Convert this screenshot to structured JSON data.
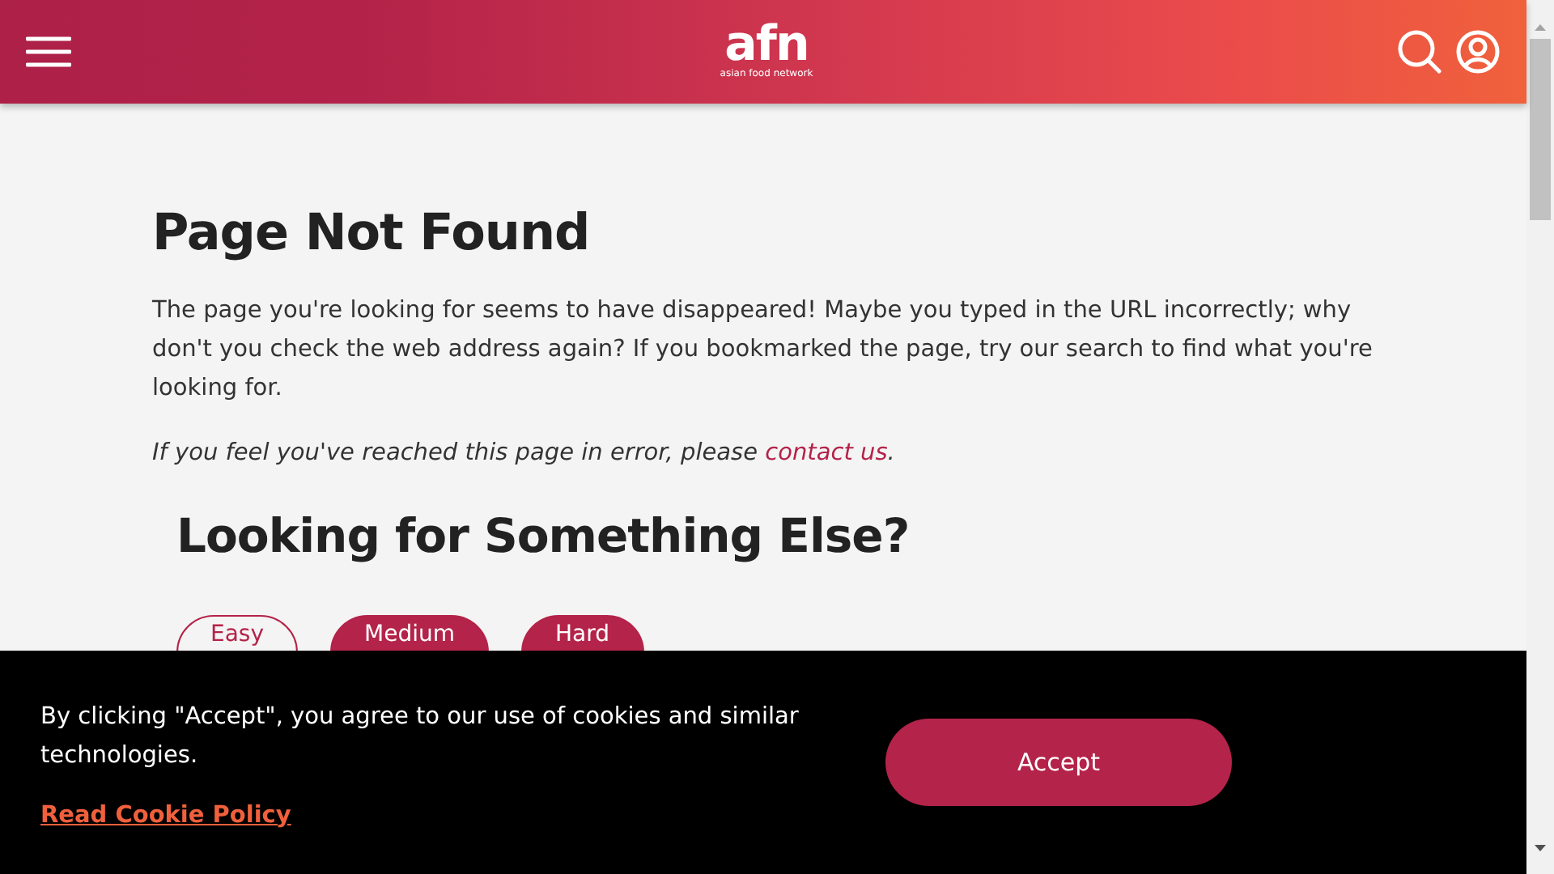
{
  "header": {
    "logo": {
      "mark": "afn",
      "tagline": "asian food network"
    }
  },
  "content": {
    "title": "Page Not Found",
    "message": "The page you're looking for seems to have disappeared! Maybe you typed in the URL incorrectly; why don't you check the web address again? If you bookmarked the page, try our search to find what you're looking for.",
    "error_note": {
      "text": "If you feel you've reached this page in error, please ",
      "link": "contact us",
      "end": "."
    },
    "section_title": "Looking for Something Else?",
    "filters": [
      {
        "label": "Easy",
        "selected": false
      },
      {
        "label": "Medium",
        "selected": true
      },
      {
        "label": "Hard",
        "selected": true
      }
    ]
  },
  "cookie_banner": {
    "text": "By clicking \"Accept\", you agree to our use of cookies and similar technologies.",
    "policy_link": "Read Cookie Policy",
    "button": "Accept"
  }
}
